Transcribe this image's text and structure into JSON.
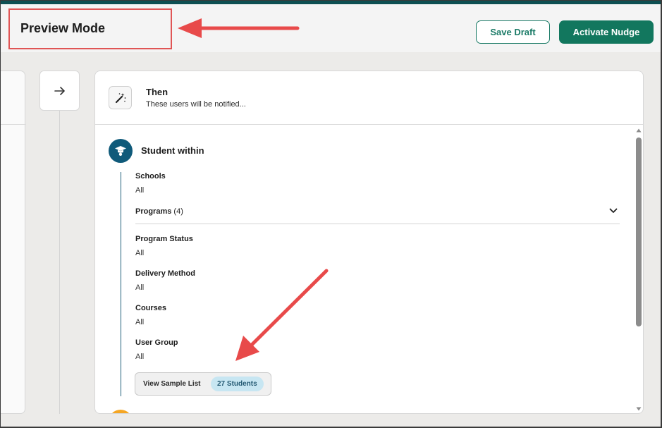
{
  "header": {
    "title": "Preview Mode",
    "save_draft_label": "Save Draft",
    "activate_label": "Activate Nudge"
  },
  "panel": {
    "head_title": "Then",
    "head_subtitle": "These users will be notified...",
    "section_title": "Student within",
    "filters": {
      "schools_label": "Schools",
      "schools_value": "All",
      "programs_label": "Programs",
      "programs_count": "(4)",
      "program_status_label": "Program Status",
      "program_status_value": "All",
      "delivery_label": "Delivery Method",
      "delivery_value": "All",
      "courses_label": "Courses",
      "courses_value": "All",
      "user_group_label": "User Group",
      "user_group_value": "All"
    },
    "view_sample_label": "View Sample List",
    "students_badge": "27 Students"
  },
  "icons": {
    "next_arrow": "arrow-right-icon",
    "wand": "magic-wand-icon",
    "student": "graduate-icon",
    "chevron": "chevron-down-icon"
  },
  "colors": {
    "brand_green": "#12775e",
    "student_blue": "#0f5a7a",
    "annotation_red": "#e05555",
    "badge_bg": "#c7e6f2"
  }
}
